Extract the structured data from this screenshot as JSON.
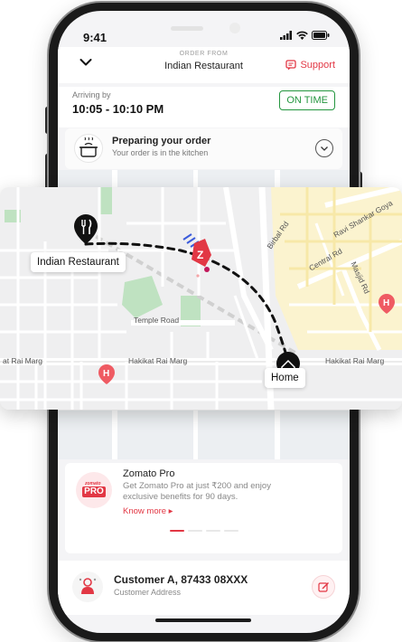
{
  "status_bar": {
    "time": "9:41"
  },
  "header": {
    "order_from_label": "ORDER FROM",
    "restaurant": "Indian Restaurant",
    "support_label": "Support"
  },
  "arrival": {
    "label": "Arriving by",
    "time": "10:05 - 10:10 PM",
    "badge": "ON TIME"
  },
  "preparing": {
    "title": "Preparing your order",
    "subtitle": "Your order is in the kitchen"
  },
  "map": {
    "restaurant_label": "Indian Restaurant",
    "home_label": "Home",
    "roads": {
      "birbal": "Birbal Rd",
      "central": "Central Rd",
      "masjid": "Masjid Rd",
      "ravi": "Ravi Shankar Goya",
      "temple": "Temple Road",
      "hakikat_left": "at Rai Marg",
      "hakikat_mid": "Hakikat Rai Marg",
      "hakikat_right": "Hakikat Rai Marg"
    }
  },
  "promo": {
    "logo_top": "zomato",
    "logo_bottom": "PRO",
    "title": "Zomato Pro",
    "description": "Get Zomato Pro at just ₹200 and enjoy exclusive benefits for 90 days.",
    "link": "Know more ▸"
  },
  "customer": {
    "name": "Customer A, 87433 08XXX",
    "address": "Customer Address"
  },
  "colors": {
    "brand": "#e23744",
    "success": "#24963f"
  }
}
